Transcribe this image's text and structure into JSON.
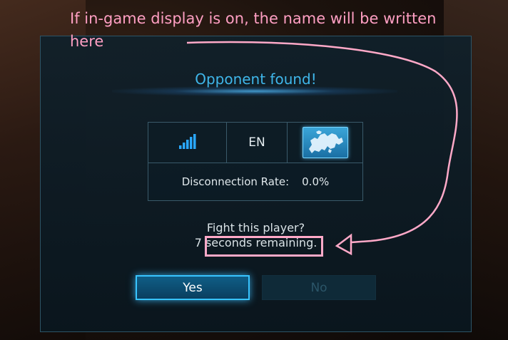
{
  "dialog": {
    "title": "Opponent found!",
    "info": {
      "connection_icon": "signal-bars-icon",
      "language": "EN",
      "region_icon": "europe-map-icon",
      "disconnection_label": "Disconnection Rate:",
      "disconnection_value": "0.0%"
    },
    "prompt_line1": "Fight this player?",
    "prompt_line2": "7 seconds remaining.",
    "yes_label": "Yes",
    "no_label": "No"
  },
  "annotation": {
    "text": "If in-game display is on, the name will be written here",
    "color": "#ff9fc3"
  },
  "colors": {
    "accent": "#3fb6ea",
    "highlight_border": "#38c4ff",
    "annotation": "#ffa9c8"
  }
}
